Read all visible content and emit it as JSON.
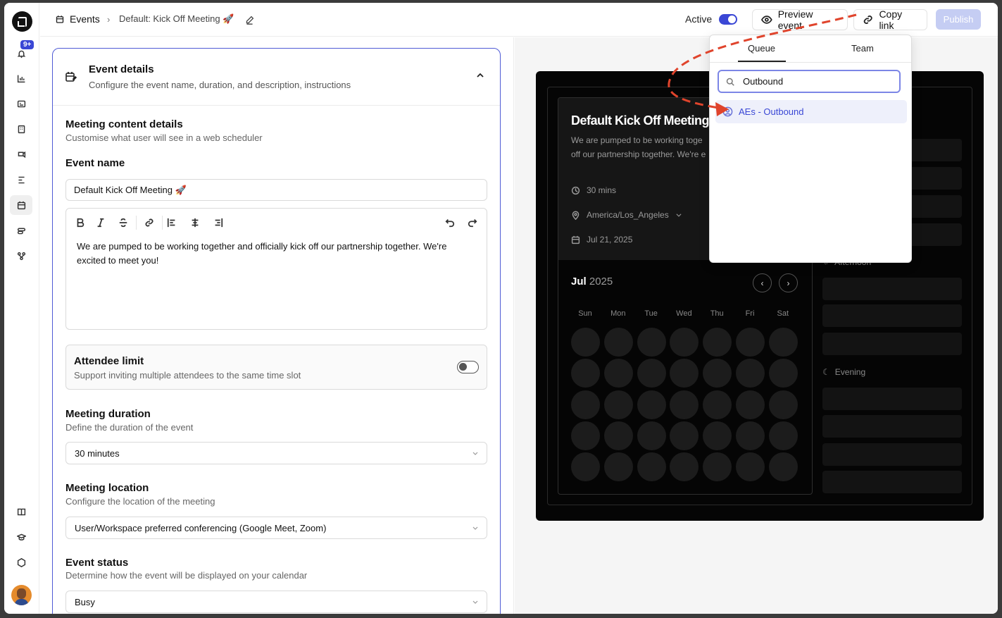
{
  "sidebar": {
    "notification_badge": "9+",
    "items": [
      {
        "name": "notifications"
      },
      {
        "name": "analytics"
      },
      {
        "name": "contacts"
      },
      {
        "name": "buildings"
      },
      {
        "name": "routing"
      },
      {
        "name": "workflows"
      },
      {
        "name": "events"
      },
      {
        "name": "integrations"
      },
      {
        "name": "git-branch"
      },
      {
        "name": "docs"
      },
      {
        "name": "academy"
      },
      {
        "name": "help"
      }
    ]
  },
  "header": {
    "breadcrumb_root": "Events",
    "breadcrumb_current": "Default: Kick Off Meeting 🚀",
    "active_label": "Active",
    "preview_label": "Preview event",
    "copy_link_label": "Copy link",
    "publish_label": "Publish"
  },
  "details": {
    "title": "Event details",
    "subtitle": "Configure the event name, duration, and description, instructions",
    "content_title": "Meeting content details",
    "content_sub": "Customise what user will see in a web scheduler",
    "event_name_label": "Event name",
    "event_name_value": "Default Kick Off Meeting 🚀",
    "description": "We are pumped to be working together and officially kick off our partnership together. We're excited to meet you!",
    "attendee_limit_title": "Attendee limit",
    "attendee_limit_sub": "Support inviting multiple attendees to the same time slot",
    "duration_title": "Meeting duration",
    "duration_sub": "Define the duration of the event",
    "duration_value": "30 minutes",
    "location_title": "Meeting location",
    "location_sub": "Configure the location of the meeting",
    "location_value": "User/Workspace preferred conferencing (Google Meet, Zoom)",
    "status_title": "Event status",
    "status_sub": "Determine how the event will be displayed on your calendar",
    "status_value": "Busy"
  },
  "preview": {
    "title": "Default Kick Off Meeting",
    "desc_line1": "We are pumped to be working toge",
    "desc_line2": "off our partnership together. We're e",
    "duration": "30 mins",
    "timezone": "America/Los_Angeles",
    "date": "Jul 21, 2025",
    "month": "Jul",
    "year": "2025",
    "weekdays": [
      "Sun",
      "Mon",
      "Tue",
      "Wed",
      "Thu",
      "Fri",
      "Sat"
    ],
    "afternoon_label": "Afternoon",
    "evening_label": "Evening"
  },
  "popup": {
    "tab_queue": "Queue",
    "tab_team": "Team",
    "search_value": "Outbound",
    "result": "AEs - Outbound"
  },
  "colors": {
    "accent": "#3a47d5",
    "annotation_arrow": "#e0442c"
  }
}
